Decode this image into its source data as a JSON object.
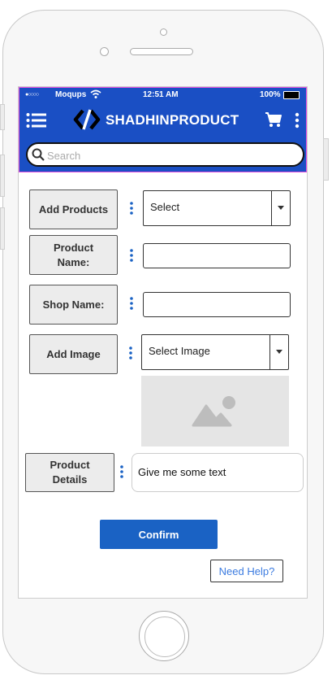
{
  "status_bar": {
    "carrier_dots": "●○○○○",
    "carrier": "Moqups",
    "time": "12:51 AM",
    "battery": "100%"
  },
  "app_bar": {
    "title": "SHADHINPRODUCT",
    "search_placeholder": "Search"
  },
  "form": {
    "add_products": {
      "label": "Add Products",
      "select_value": "Select"
    },
    "product_name": {
      "label": "Product Name:",
      "value": ""
    },
    "shop_name": {
      "label": "Shop Name:",
      "value": ""
    },
    "add_image": {
      "label": "Add Image",
      "select_value": "Select Image"
    },
    "product_details": {
      "label": "Product Details",
      "value": "Give me some text"
    }
  },
  "actions": {
    "confirm_label": "Confirm",
    "help_label": "Need Help?"
  },
  "colors": {
    "app_bar": "#1a4fc4",
    "confirm": "#1a62c4",
    "help_text": "#3b7be0",
    "dots": "#1a62c4"
  },
  "icons": [
    "hamburger-menu-icon",
    "logo-icon",
    "cart-icon",
    "more-vertical-icon",
    "search-icon",
    "wifi-icon",
    "battery-icon",
    "image-placeholder-icon",
    "dropdown-arrow-icon"
  ]
}
